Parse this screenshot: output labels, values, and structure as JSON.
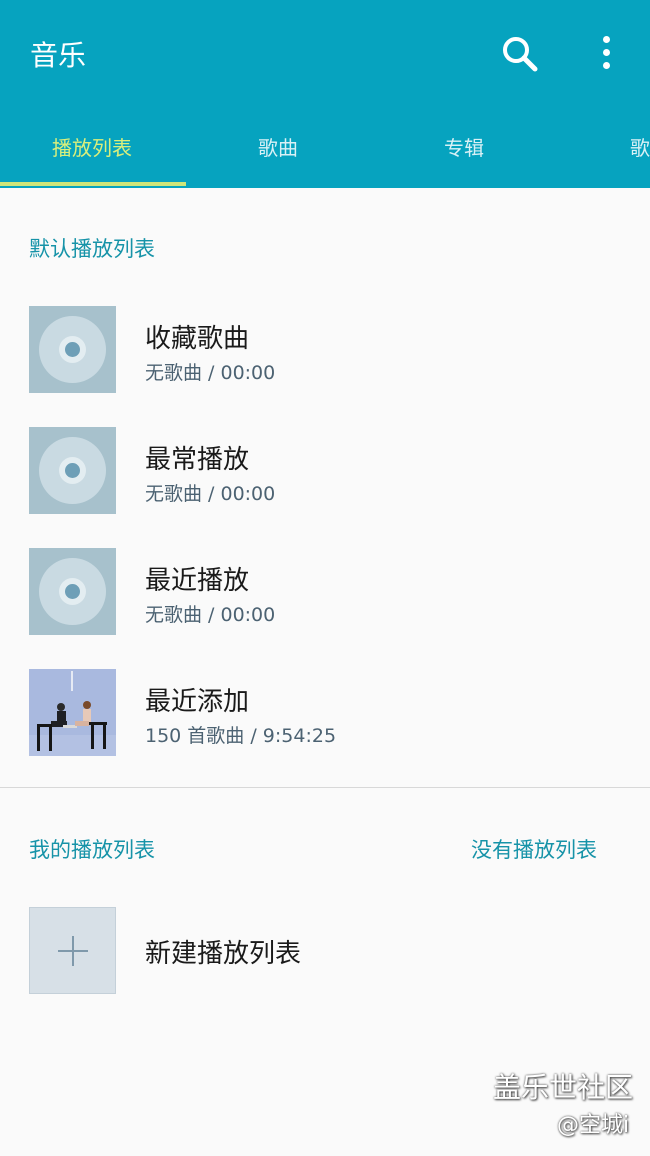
{
  "app_bar": {
    "title": "音乐"
  },
  "tabs": [
    {
      "label": "播放列表",
      "active": true
    },
    {
      "label": "歌曲",
      "active": false
    },
    {
      "label": "专辑",
      "active": false
    },
    {
      "label": "歌",
      "active": false
    }
  ],
  "default_section": {
    "label": "默认播放列表",
    "items": [
      {
        "title": "收藏歌曲",
        "subtitle": "无歌曲 / 00:00",
        "thumb": "disc-icon"
      },
      {
        "title": "最常播放",
        "subtitle": "无歌曲 / 00:00",
        "thumb": "disc-icon"
      },
      {
        "title": "最近播放",
        "subtitle": "无歌曲 / 00:00",
        "thumb": "disc-icon"
      },
      {
        "title": "最近添加",
        "subtitle": "150 首歌曲 / 9:54:25",
        "thumb": "album-photo"
      }
    ]
  },
  "my_section": {
    "label": "我的播放列表",
    "status": "没有播放列表",
    "new_playlist_label": "新建播放列表"
  },
  "watermark": {
    "line1": "盖乐世社区",
    "line2": "@空城i"
  },
  "colors": {
    "app_bar": "#06a3bf",
    "tab_active": "#d9ef7c",
    "section_label": "#1693a8"
  }
}
